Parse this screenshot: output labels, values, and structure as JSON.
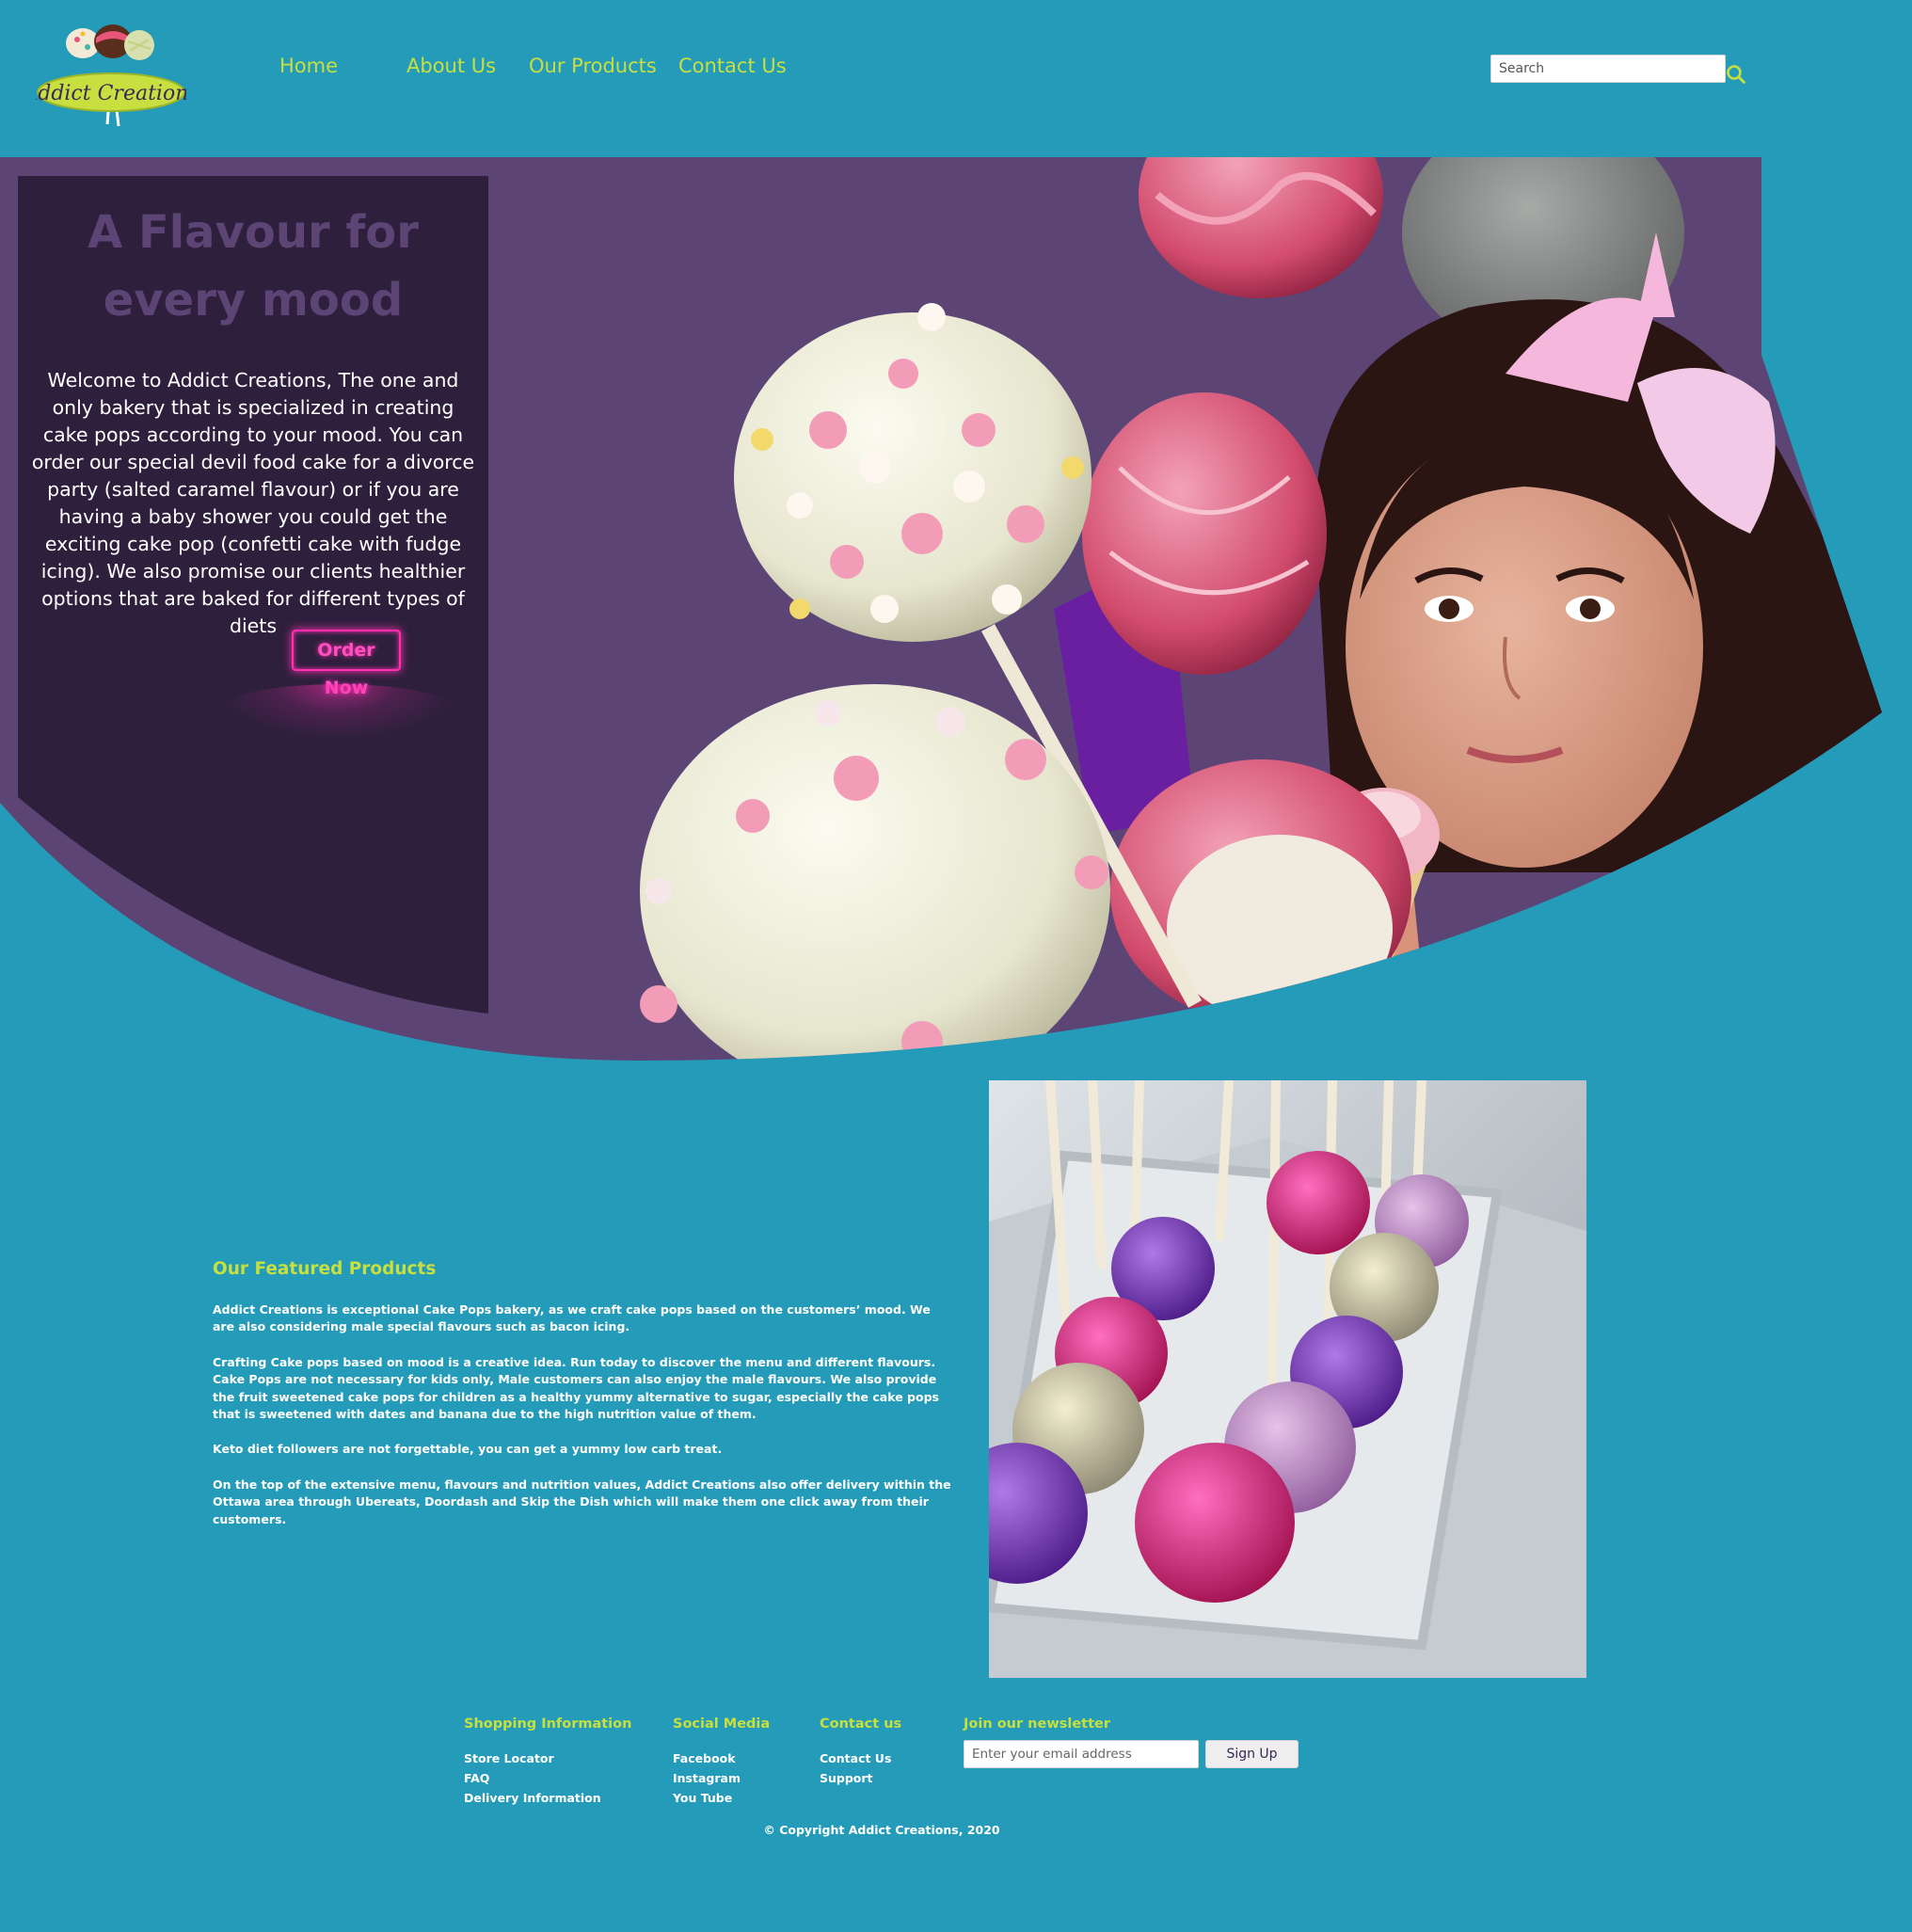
{
  "brand": {
    "logo_text": "Addict Creations",
    "accent_color": "#c7df3f",
    "background_color": "#249bb8",
    "hero_purple": "#5c4575",
    "neon_pink": "#ff2fb0"
  },
  "nav": {
    "items": [
      {
        "label": "Home"
      },
      {
        "label": "About Us"
      },
      {
        "label": "Our Products"
      },
      {
        "label": "Contact Us"
      }
    ]
  },
  "search": {
    "placeholder": "Search",
    "icon": "search-icon"
  },
  "hero": {
    "title_line1": "A Flavour for",
    "title_line2": "every mood",
    "text": "Welcome to Addict Creations, The one and only bakery that is specialized in creating cake pops according to your mood. You can order our special devil food cake for a divorce party (salted caramel flavour) or if you are having a baby shower you could get the exciting cake pop (confetti cake with fudge icing). We also promise our clients healthier options that are baked for different types of diets",
    "button_label": "Order Now"
  },
  "featured": {
    "title": "Our Featured Products",
    "paragraphs": [
      "Addict Creations is exceptional Cake Pops bakery, as we craft cake pops based on the customers’ mood. We are also considering male special flavours such as bacon icing.",
      "Crafting Cake pops based on mood is a creative idea. Run today to discover the menu and different flavours. Cake Pops are not necessary for kids only, Male customers can also enjoy the male flavours. We also provide the fruit sweetened cake pops for children as a healthy yummy alternative to sugar, especially the cake pops that is sweetened with dates and banana due to the high nutrition value of them.",
      "Keto diet followers are not forgettable, you can get a yummy low carb treat.",
      "On the top of the extensive menu, flavours and nutrition values, Addict Creations also offer delivery within the Ottawa area through Ubereats, Doordash and Skip the Dish which will make them one click away from their customers."
    ]
  },
  "footer": {
    "shopping": {
      "title": "Shopping Information",
      "links": [
        "Store Locator",
        "FAQ",
        "Delivery Information"
      ]
    },
    "social": {
      "title": "Social Media",
      "links": [
        "Facebook",
        "Instagram",
        "You Tube"
      ]
    },
    "contact": {
      "title": "Contact us",
      "links": [
        "Contact Us",
        "Support"
      ]
    },
    "newsletter": {
      "title": "Join our newsletter",
      "placeholder": "Enter your email address",
      "button_label": "Sign Up"
    },
    "copyright": "© Copyright Addict Creations, 2020"
  }
}
